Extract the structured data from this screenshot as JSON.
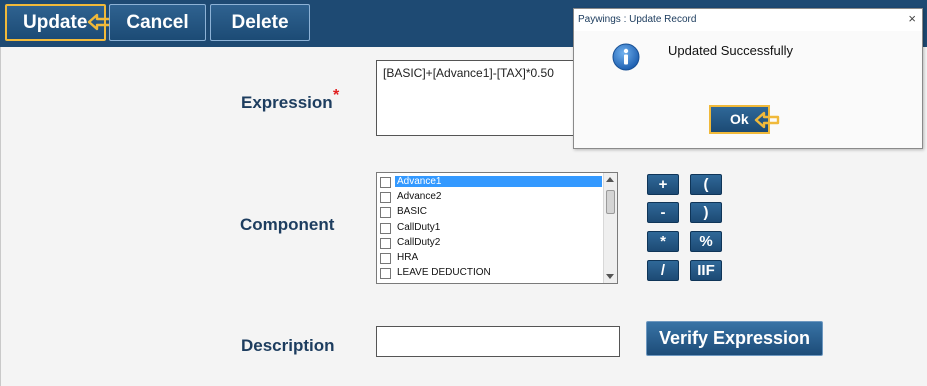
{
  "toolbar": {
    "update_label": "Update",
    "cancel_label": "Cancel",
    "delete_label": "Delete"
  },
  "form": {
    "expression_label": "Expression",
    "required_marker": "*",
    "expression_value": "[BASIC]+[Advance1]-[TAX]*0.50",
    "component_label": "Component",
    "components": [
      "Advance1",
      "Advance2",
      "BASIC",
      "CallDuty1",
      "CallDuty2",
      "HRA",
      "LEAVE DEDUCTION"
    ],
    "selected_component": "Advance1",
    "operators": [
      "+",
      "(",
      "-",
      ")",
      "*",
      "%",
      "/",
      "IIF"
    ],
    "description_label": "Description",
    "description_value": "",
    "verify_label": "Verify Expression"
  },
  "dialog": {
    "title": "Paywings : Update Record",
    "close_glyph": "×",
    "message": "Updated Successfully",
    "ok_label": "Ok",
    "icon": "info-icon"
  },
  "colors": {
    "toolbar_bg": "#1e4a73",
    "button_bg": "#2a5d8a",
    "focus_border": "#f0b93a",
    "label_text": "#1d3d5f",
    "required": "#e02020",
    "selection": "#3399ff"
  }
}
